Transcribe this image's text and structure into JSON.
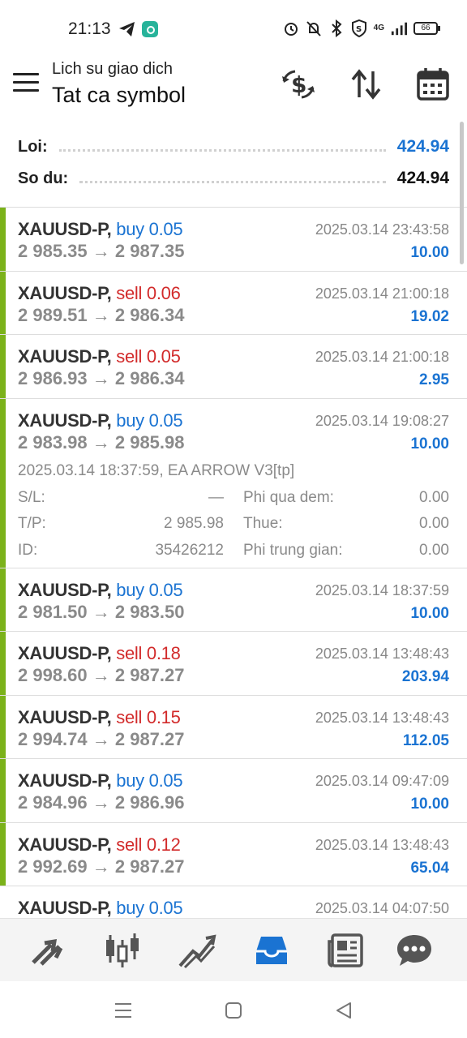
{
  "status_bar": {
    "time": "21:13",
    "network": "4G",
    "battery": "66"
  },
  "header": {
    "subtitle": "Lich su giao dich",
    "title": "Tat ca symbol"
  },
  "summary": {
    "profit_label": "Loi:",
    "profit_value": "424.94",
    "balance_label": "So du:",
    "balance_value": "424.94"
  },
  "trades": [
    {
      "symbol": "XAUUSD-P,",
      "side": "buy 0.05",
      "datetime": "2025.03.14 23:43:58",
      "prices": "2 985.35 → 2 987.35",
      "profit": "10.00"
    },
    {
      "symbol": "XAUUSD-P,",
      "side": "sell 0.06",
      "datetime": "2025.03.14 21:00:18",
      "prices": "2 989.51 → 2 986.34",
      "profit": "19.02"
    },
    {
      "symbol": "XAUUSD-P,",
      "side": "sell 0.05",
      "datetime": "2025.03.14 21:00:18",
      "prices": "2 986.93 → 2 986.34",
      "profit": "2.95"
    },
    {
      "symbol": "XAUUSD-P,",
      "side": "buy 0.05",
      "datetime": "2025.03.14 19:08:27",
      "prices": "2 983.98 → 2 985.98",
      "profit": "10.00"
    },
    {
      "symbol": "XAUUSD-P,",
      "side": "buy 0.05",
      "datetime": "2025.03.14 18:37:59",
      "prices": "2 981.50 → 2 983.50",
      "profit": "10.00"
    },
    {
      "symbol": "XAUUSD-P,",
      "side": "sell 0.18",
      "datetime": "2025.03.14 13:48:43",
      "prices": "2 998.60 → 2 987.27",
      "profit": "203.94"
    },
    {
      "symbol": "XAUUSD-P,",
      "side": "sell 0.15",
      "datetime": "2025.03.14 13:48:43",
      "prices": "2 994.74 → 2 987.27",
      "profit": "112.05"
    },
    {
      "symbol": "XAUUSD-P,",
      "side": "buy 0.05",
      "datetime": "2025.03.14 09:47:09",
      "prices": "2 984.96 → 2 986.96",
      "profit": "10.00"
    },
    {
      "symbol": "XAUUSD-P,",
      "side": "sell 0.12",
      "datetime": "2025.03.14 13:48:43",
      "prices": "2 992.69 → 2 987.27",
      "profit": "65.04"
    },
    {
      "symbol": "XAUUSD-P,",
      "side": "buy 0.05",
      "datetime": "2025.03.14 04:07:50",
      "prices": "",
      "profit": ""
    }
  ],
  "expanded": {
    "open_info": "2025.03.14 18:37:59, EA ARROW V3[tp]",
    "sl_label": "S/L:",
    "sl_value": "—",
    "tp_label": "T/P:",
    "tp_value": "2 985.98",
    "id_label": "ID:",
    "id_value": "35426212",
    "swap_label": "Phi qua dem:",
    "swap_value": "0.00",
    "tax_label": "Thue:",
    "tax_value": "0.00",
    "commission_label": "Phi trung gian:",
    "commission_value": "0.00"
  },
  "bottom_nav": [
    "trade-arrows-icon",
    "candlestick-chart-icon",
    "trend-line-icon",
    "history-inbox-icon",
    "news-icon",
    "chat-icon"
  ],
  "colors": {
    "buy": "#1a73d2",
    "sell": "#d22b2b",
    "profit": "#1a73d2",
    "accent_bar": "#7bb21a",
    "active_nav": "#1a73d2"
  }
}
